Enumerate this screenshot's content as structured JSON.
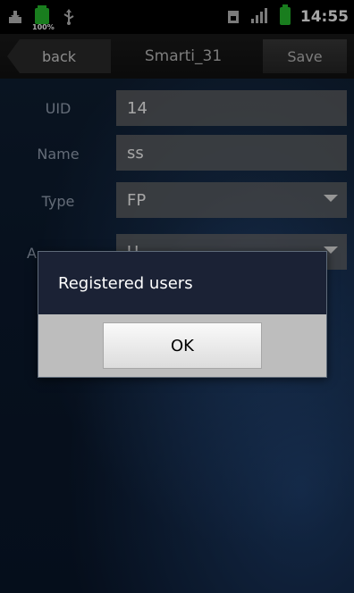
{
  "status_bar": {
    "battery_label": "100%",
    "time": "14:55"
  },
  "topbar": {
    "back_label": "back",
    "title": "Smarti_31",
    "save_label": "Save"
  },
  "form": {
    "uid_label": "UID",
    "uid_value": "14",
    "name_label": "Name",
    "name_value": "ss",
    "type_label": "Type",
    "type_value": "FP",
    "access_label": "A",
    "access_value": "U"
  },
  "dialog": {
    "message": "Registered users",
    "ok_label": "OK"
  },
  "colors": {
    "battery_green": "#27c12f"
  }
}
